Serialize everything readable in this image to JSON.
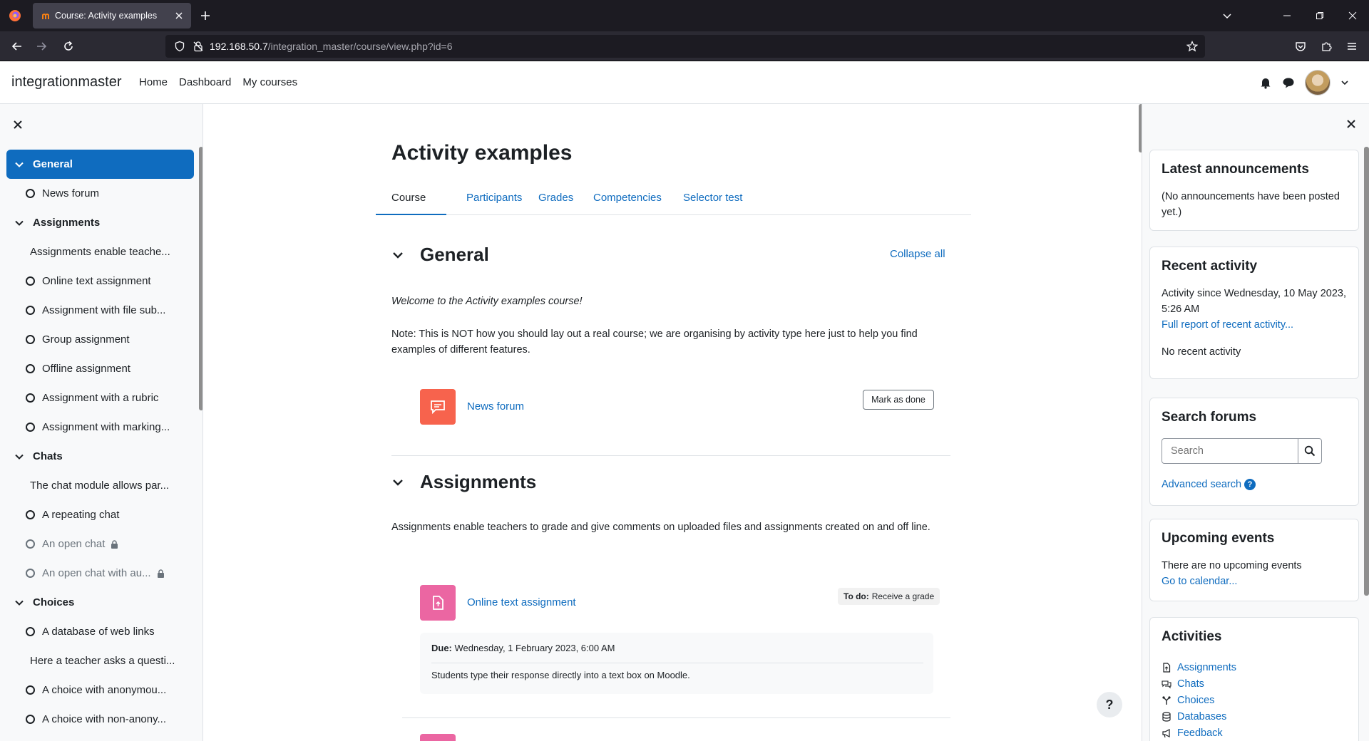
{
  "browser": {
    "tab_title": "Course: Activity examples",
    "url_host": "192.168.50.7",
    "url_path": "/integration_master/course/view.php?id=6"
  },
  "header": {
    "brand": "integrationmaster",
    "nav": [
      "Home",
      "Dashboard",
      "My courses"
    ]
  },
  "course_index": {
    "items": [
      {
        "kind": "section",
        "label": "General",
        "active": true
      },
      {
        "kind": "activity",
        "label": "News forum"
      },
      {
        "kind": "section",
        "label": "Assignments"
      },
      {
        "kind": "label",
        "label": "Assignments enable teache..."
      },
      {
        "kind": "activity",
        "label": "Online text assignment"
      },
      {
        "kind": "activity",
        "label": "Assignment with file sub..."
      },
      {
        "kind": "activity",
        "label": "Group assignment"
      },
      {
        "kind": "activity",
        "label": "Offline assignment"
      },
      {
        "kind": "activity",
        "label": "Assignment with a rubric"
      },
      {
        "kind": "activity",
        "label": "Assignment with marking..."
      },
      {
        "kind": "section",
        "label": "Chats"
      },
      {
        "kind": "label",
        "label": "The chat module allows par..."
      },
      {
        "kind": "activity",
        "label": "A repeating chat"
      },
      {
        "kind": "activity",
        "label": "An open chat",
        "locked": true
      },
      {
        "kind": "activity",
        "label": "An open chat with au...",
        "locked": true
      },
      {
        "kind": "section",
        "label": "Choices"
      },
      {
        "kind": "activity",
        "label": "A database of web links"
      },
      {
        "kind": "label",
        "label": "Here a teacher asks a questi..."
      },
      {
        "kind": "activity",
        "label": "A choice with anonymou..."
      },
      {
        "kind": "activity",
        "label": "A choice with non-anony..."
      }
    ]
  },
  "main": {
    "title": "Activity examples",
    "tabs": [
      "Course",
      "Participants",
      "Grades",
      "Competencies",
      "Selector test"
    ],
    "collapse_all": "Collapse all",
    "general": {
      "heading": "General",
      "welcome": "Welcome to the Activity examples course!",
      "note": "Note: This is NOT how you should lay out a real course; we are organising by activity type here just to help you find examples of different features.",
      "forum_link": "News forum",
      "mark_done": "Mark as done"
    },
    "assignments": {
      "heading": "Assignments",
      "intro": "Assignments enable teachers to grade and give comments on uploaded files and assignments created on and off line.",
      "activity_link": "Online text assignment",
      "todo_label": "To do:",
      "todo_value": "Receive a grade",
      "due_label": "Due:",
      "due_value": "Wednesday, 1 February 2023, 6:00 AM",
      "description": "Students type their response directly into a text box on Moodle."
    },
    "help": "?"
  },
  "blocks": {
    "announcements": {
      "title": "Latest announcements",
      "text": "(No announcements have been posted yet.)"
    },
    "recent": {
      "title": "Recent activity",
      "since": "Activity since Wednesday, 10 May 2023, 5:26 AM",
      "full_report": "Full report of recent activity...",
      "none": "No recent activity"
    },
    "search": {
      "title": "Search forums",
      "placeholder": "Search",
      "advanced": "Advanced search"
    },
    "events": {
      "title": "Upcoming events",
      "none": "There are no upcoming events",
      "calendar": "Go to calendar..."
    },
    "activities": {
      "title": "Activities",
      "items": [
        "Assignments",
        "Chats",
        "Choices",
        "Databases",
        "Feedback"
      ]
    }
  },
  "colors": {
    "primary": "#0f6cbf",
    "forum": "#f7634d",
    "assign": "#eb66a2"
  }
}
